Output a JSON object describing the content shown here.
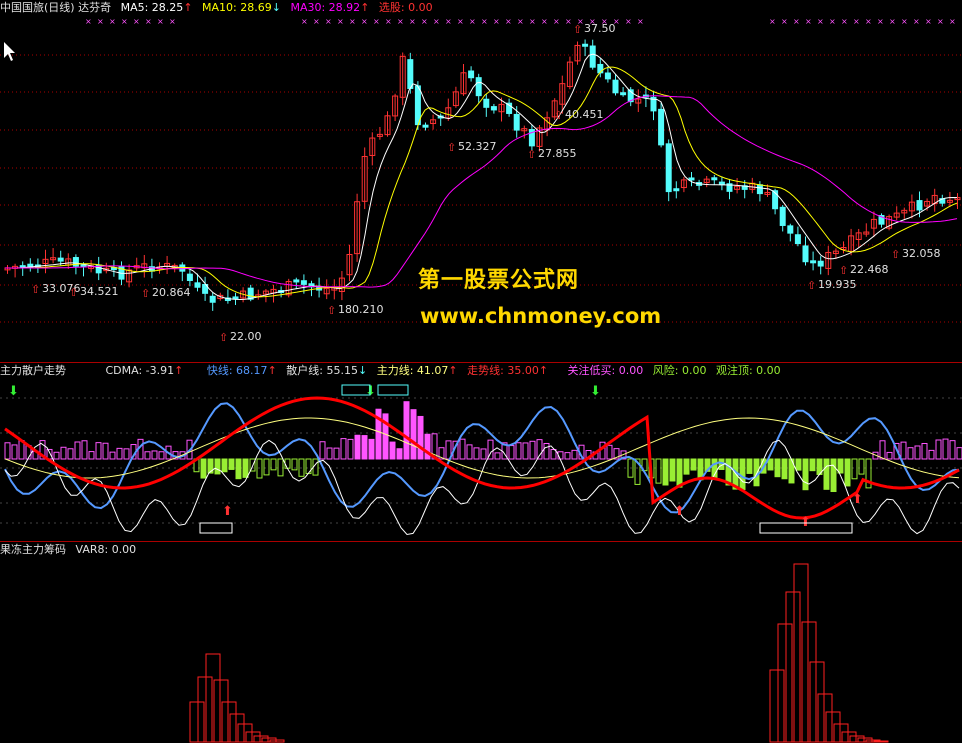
{
  "main_header": {
    "title": "中国国旅(日线) 达芬奇",
    "ma5": "MA5: 28.25",
    "ma5_arrow": "↑",
    "ma10": "MA10: 28.69",
    "ma10_arrow": "↓",
    "ma30": "MA30: 28.92",
    "ma30_arrow": "↑",
    "select": "选股: 0.00"
  },
  "price_labels": [
    "37.50",
    "40.451",
    "52.327",
    "27.855",
    "33.076",
    "34.521",
    "20.864",
    "22.00",
    "180.210",
    "19.935",
    "22.468",
    "32.058"
  ],
  "watermark": {
    "line1": "第一股票公式网",
    "line2": "www.chnmoney.com"
  },
  "indicator1": {
    "title": "主力散户走势",
    "cdma": "CDMA: -3.91",
    "fast": "快线: 68.17",
    "retail": "散户线: 55.15",
    "main": "主力线: 41.07",
    "trend": "走势线: 35.00",
    "focus": "关注低买: 0.00",
    "risk": "风险: 0.00",
    "watch": "观注顶: 0.00",
    "arrow_up": "↑",
    "arrow_down": "↓"
  },
  "indicator2": {
    "title": "果冻主力筹码",
    "var": "VAR8: 0.00"
  },
  "colors": {
    "up": "#ff3232",
    "down": "#54fcfc",
    "ma5": "#ffffff",
    "ma10": "#ffff00",
    "ma30": "#ff00ff",
    "fast": "#5599ff",
    "trend": "#ff0000",
    "main": "#ffff80",
    "pos": "#ff55ff",
    "neg": "#99ee33",
    "label": "#e0e0e0"
  }
}
